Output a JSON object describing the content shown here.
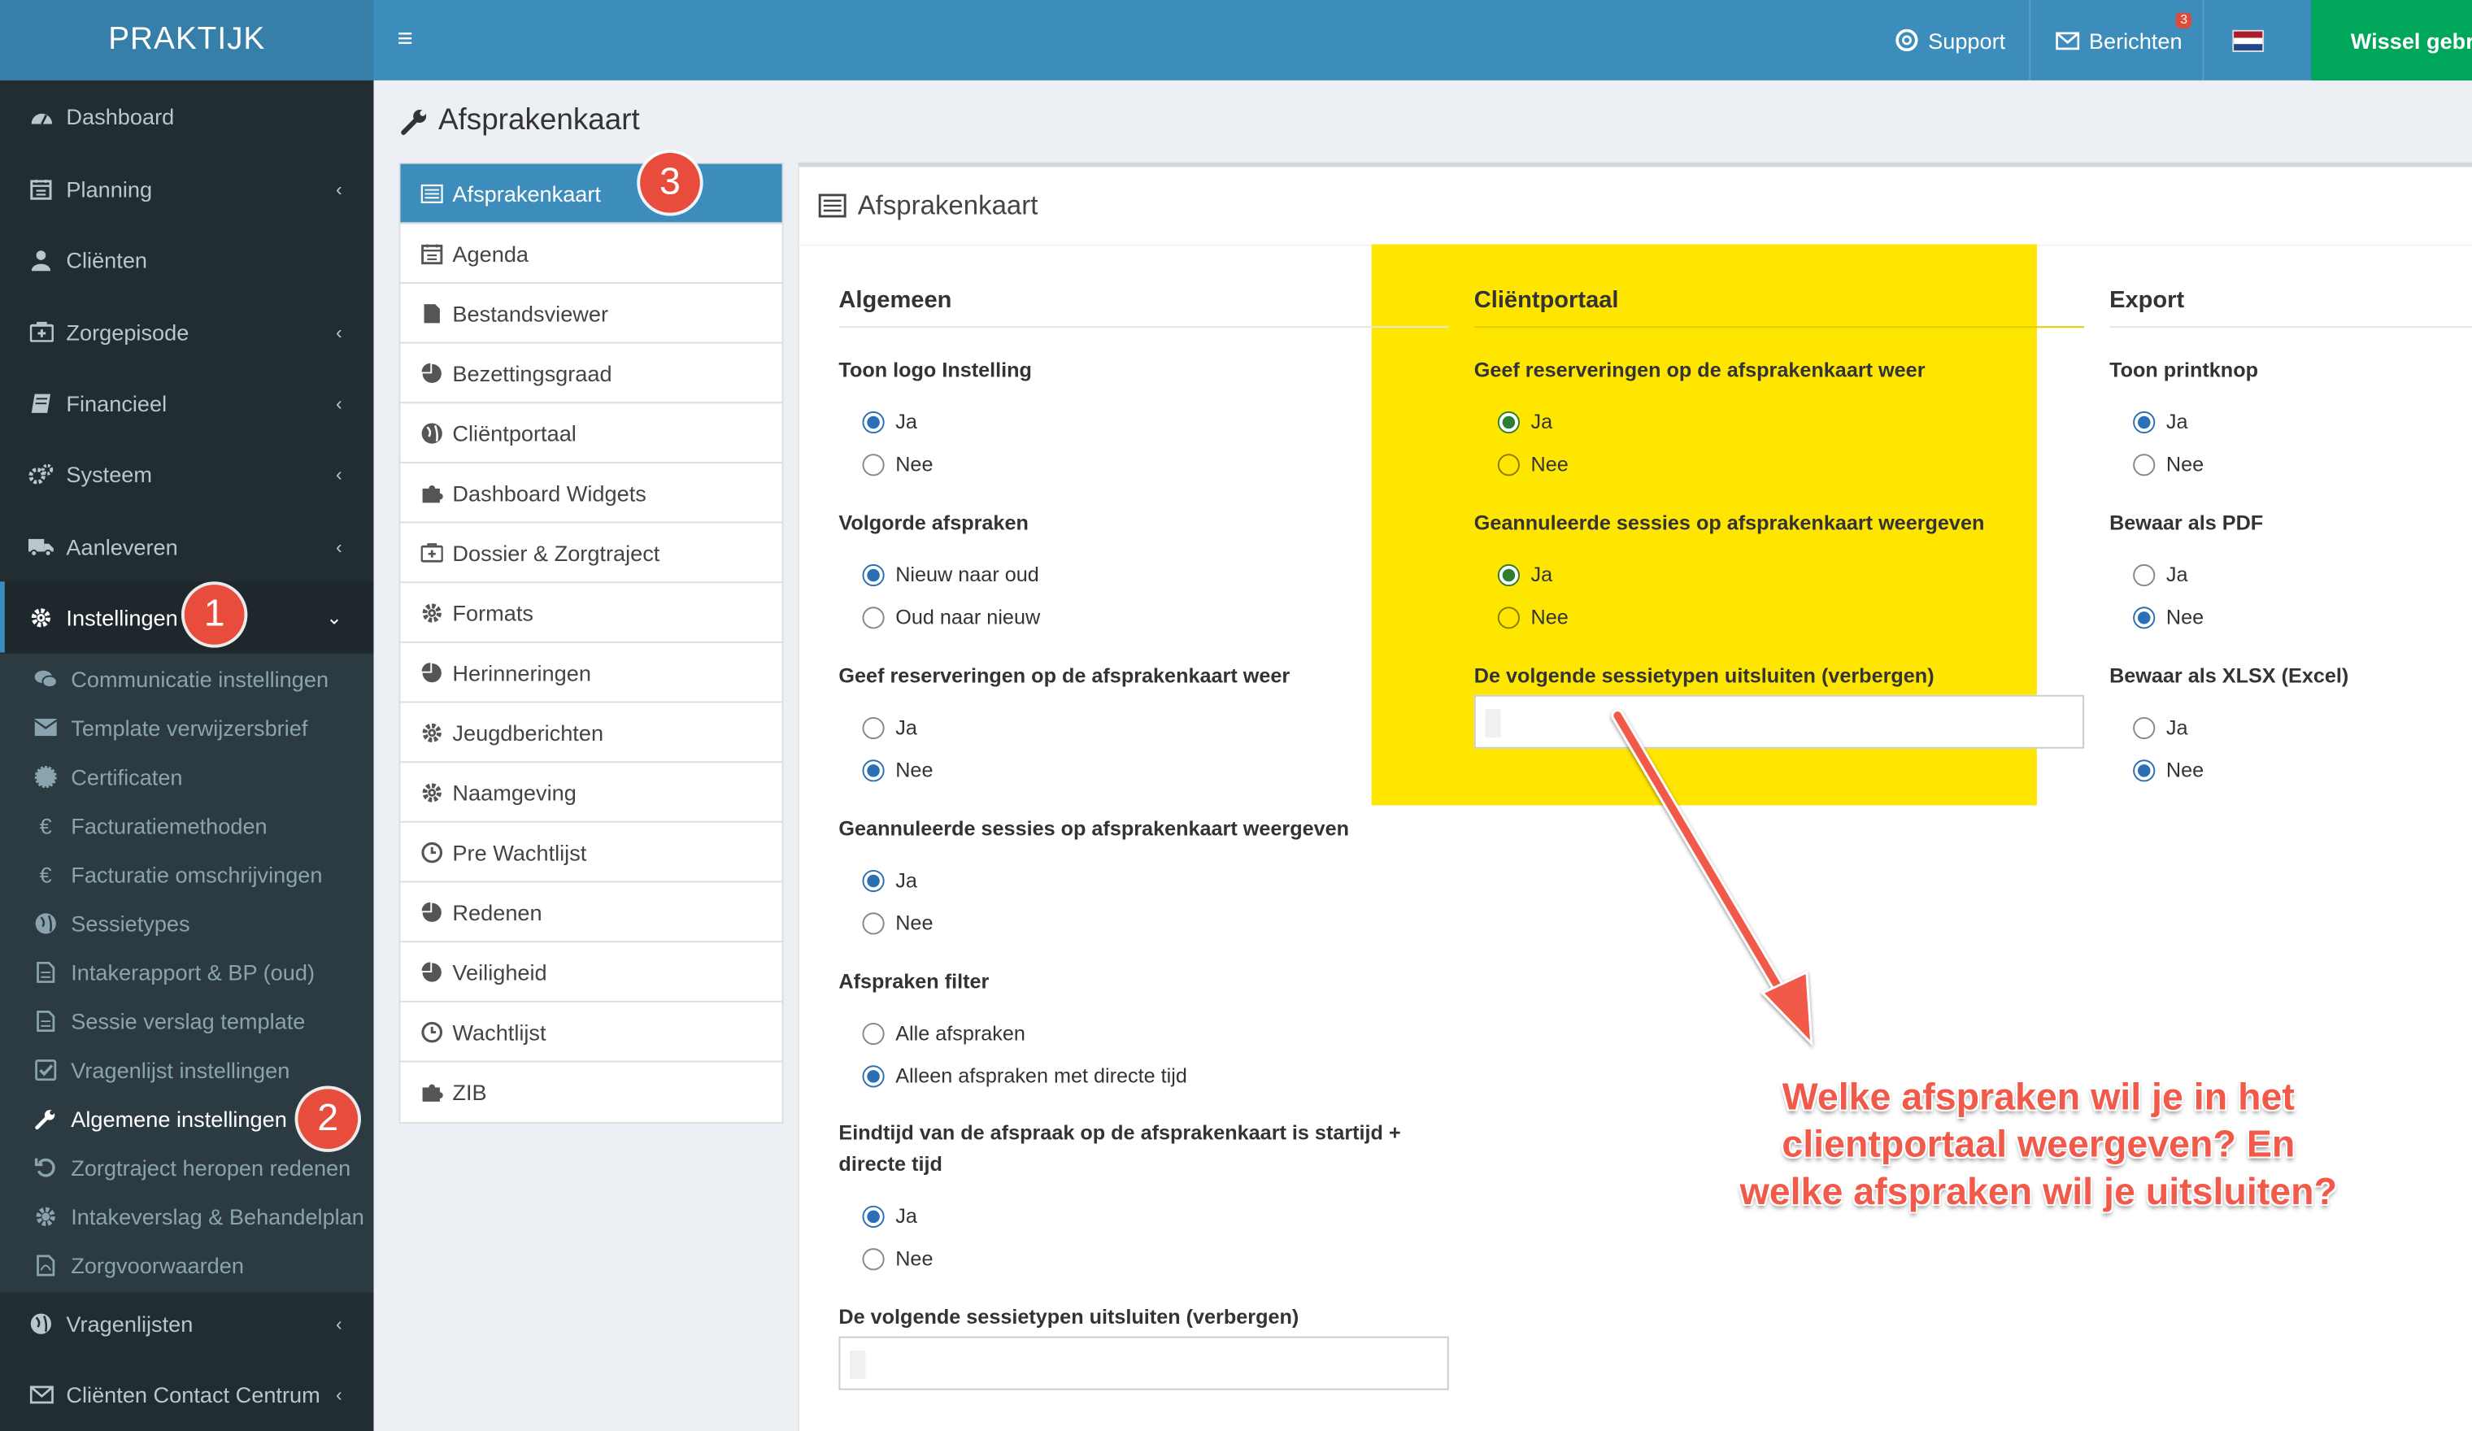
{
  "app": {
    "logo": "PRAKTIJK"
  },
  "topbar": {
    "support_label": "Support",
    "messages_label": "Berichten",
    "messages_count": "3",
    "switch_user_label": "Wissel gebrui"
  },
  "sidebar": {
    "items": [
      {
        "label": "Dashboard",
        "icon": "dashboard-icon"
      },
      {
        "label": "Planning",
        "icon": "calendar-icon"
      },
      {
        "label": "Cliënten",
        "icon": "user-icon"
      },
      {
        "label": "Zorgepisode",
        "icon": "medkit-icon"
      },
      {
        "label": "Financieel",
        "icon": "book-icon"
      },
      {
        "label": "Systeem",
        "icon": "cogs-icon"
      },
      {
        "label": "Aanleveren",
        "icon": "truck-icon"
      },
      {
        "label": "Instellingen",
        "icon": "gear-icon"
      },
      {
        "label": "Vragenlijsten",
        "icon": "globe-icon"
      },
      {
        "label": "Cliënten Contact Centrum",
        "icon": "envelope-icon"
      }
    ],
    "subitems": [
      {
        "label": "Communicatie instellingen",
        "icon": "comments-icon"
      },
      {
        "label": "Template verwijzersbrief",
        "icon": "envelope-icon"
      },
      {
        "label": "Certificaten",
        "icon": "certificate-icon"
      },
      {
        "label": "Facturatiemethoden",
        "icon": "euro-icon"
      },
      {
        "label": "Facturatie omschrijvingen",
        "icon": "euro-icon"
      },
      {
        "label": "Sessietypes",
        "icon": "globe-icon"
      },
      {
        "label": "Intakerapport & BP (oud)",
        "icon": "file-icon"
      },
      {
        "label": "Sessie verslag template",
        "icon": "file-icon"
      },
      {
        "label": "Vragenlijst instellingen",
        "icon": "check-square-icon"
      },
      {
        "label": "Algemene instellingen",
        "icon": "wrench-icon"
      },
      {
        "label": "Zorgtraject heropen redenen",
        "icon": "undo-icon"
      },
      {
        "label": "Intakeverslag & Behandelplan",
        "icon": "cog-icon"
      },
      {
        "label": "Zorgvoorwaarden",
        "icon": "pdf-icon"
      }
    ]
  },
  "badges": {
    "one": "1",
    "two": "2",
    "three": "3"
  },
  "page": {
    "title": "Afsprakenkaart"
  },
  "subnav": {
    "items": [
      {
        "label": "Afsprakenkaart",
        "icon": "list-alt-icon"
      },
      {
        "label": "Agenda",
        "icon": "calendar-icon"
      },
      {
        "label": "Bestandsviewer",
        "icon": "file-icon"
      },
      {
        "label": "Bezettingsgraad",
        "icon": "pie-chart-icon"
      },
      {
        "label": "Cliëntportaal",
        "icon": "globe-icon"
      },
      {
        "label": "Dashboard Widgets",
        "icon": "puzzle-icon"
      },
      {
        "label": "Dossier & Zorgtraject",
        "icon": "medkit-icon"
      },
      {
        "label": "Formats",
        "icon": "gear-icon"
      },
      {
        "label": "Herinneringen",
        "icon": "pie-chart-icon"
      },
      {
        "label": "Jeugdberichten",
        "icon": "gear-icon"
      },
      {
        "label": "Naamgeving",
        "icon": "gear-icon"
      },
      {
        "label": "Pre Wachtlijst",
        "icon": "clock-icon"
      },
      {
        "label": "Redenen",
        "icon": "pie-chart-icon"
      },
      {
        "label": "Veiligheid",
        "icon": "pie-chart-icon"
      },
      {
        "label": "Wachtlijst",
        "icon": "clock-icon"
      },
      {
        "label": "ZIB",
        "icon": "puzzle-icon"
      }
    ]
  },
  "panel": {
    "title": "Afsprakenkaart",
    "algemeen": {
      "title": "Algemeen",
      "logo_label": "Toon logo Instelling",
      "order_label": "Volgorde afspraken",
      "order_new": "Nieuw naar oud",
      "order_old": "Oud naar nieuw",
      "reservations_label": "Geef reserveringen op de afsprakenkaart weer",
      "cancelled_label": "Geannuleerde sessies op afsprakenkaart weergeven",
      "filter_label": "Afspraken filter",
      "filter_all": "Alle afspraken",
      "filter_direct": "Alleen afspraken met directe tijd",
      "endtime_label": "Eindtijd van de afspraak op de afsprakenkaart is startijd + directe tijd",
      "exclude_label": "De volgende sessietypen uitsluiten (verbergen)"
    },
    "clientportaal": {
      "title": "Cliëntportaal",
      "reservations_label": "Geef reserveringen op de afsprakenkaart weer",
      "cancelled_label": "Geannuleerde sessies op afsprakenkaart weergeven",
      "exclude_label": "De volgende sessietypen uitsluiten (verbergen)"
    },
    "export": {
      "title": "Export",
      "print_label": "Toon printknop",
      "pdf_label": "Bewaar als PDF",
      "xlsx_label": "Bewaar als XLSX (Excel)"
    },
    "yes": "Ja",
    "no": "Nee"
  },
  "annotation": {
    "line1": "Welke afspraken wil je in het",
    "line2": "clientportaal weergeven? En",
    "line3": "welke afspraken wil je uitsluiten?",
    "highlight_color": "#ffe600",
    "text_color": "#f15a4a"
  }
}
